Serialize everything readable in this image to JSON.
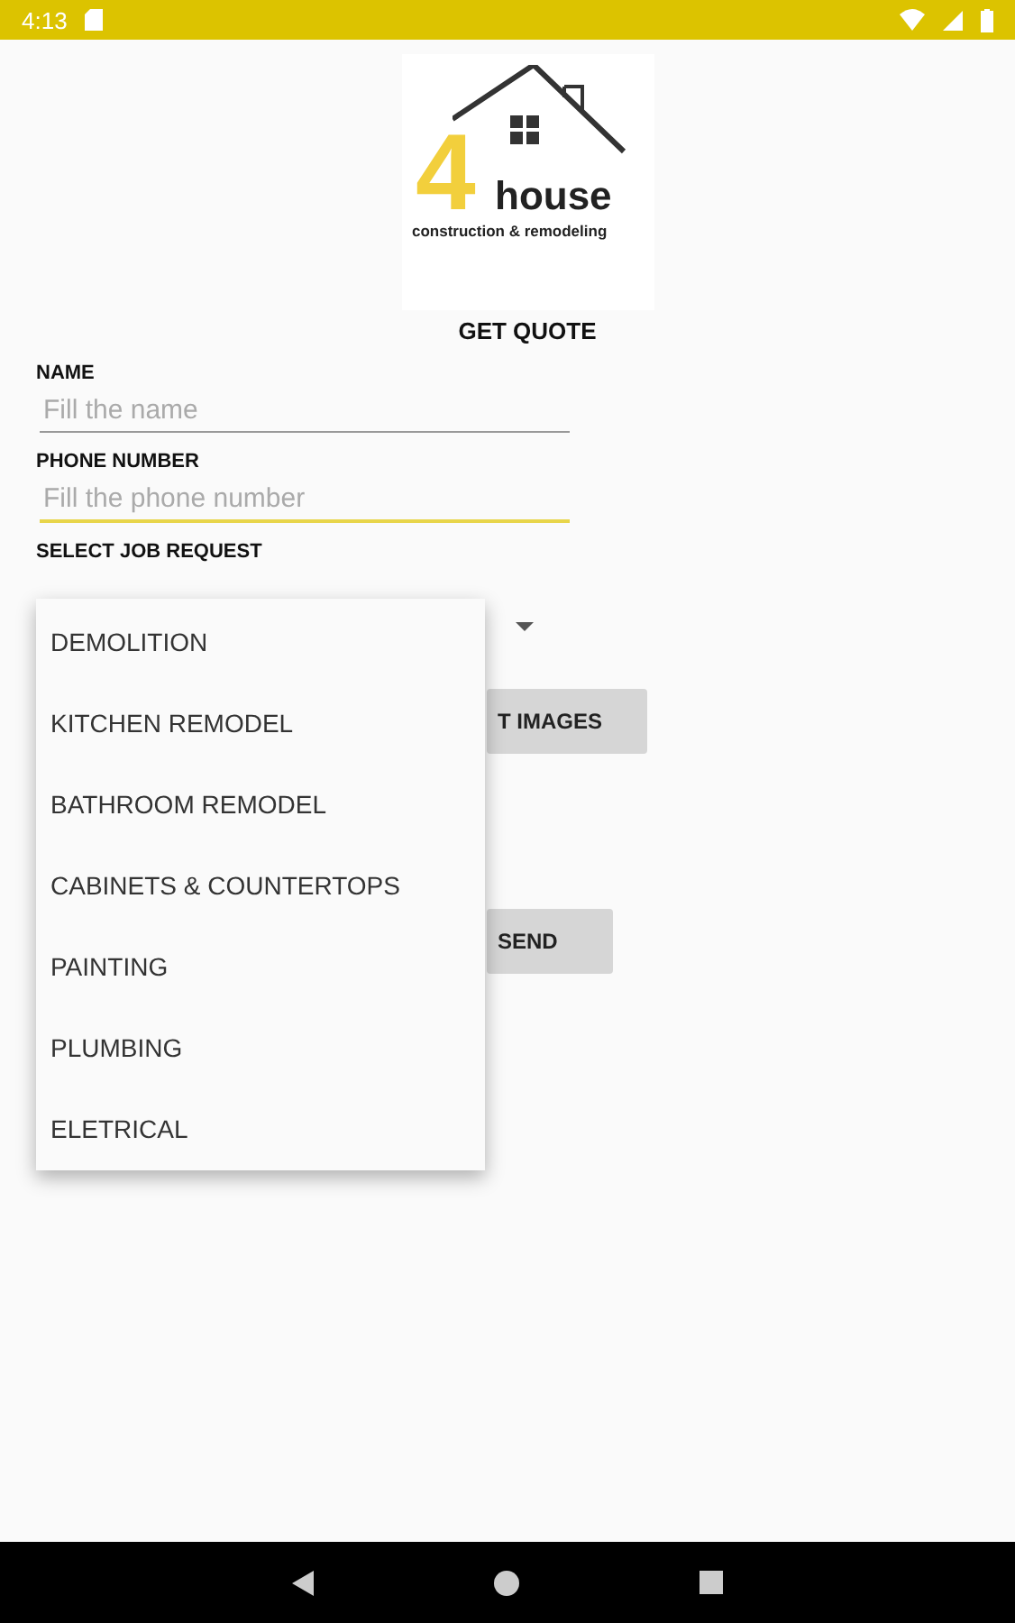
{
  "status_bar": {
    "time": "4:13"
  },
  "logo": {
    "digit": "4",
    "word": "house",
    "tagline": "construction & remodeling"
  },
  "title": "GET QUOTE",
  "fields": [
    {
      "label": "NAME",
      "placeholder": "Fill the name",
      "focused": false
    },
    {
      "label": "PHONE NUMBER",
      "placeholder": "Fill the phone number",
      "focused": true
    }
  ],
  "job_request": {
    "label": "SELECT JOB REQUEST",
    "expanded": true,
    "options": [
      "DEMOLITION",
      "KITCHEN REMODEL",
      "BATHROOM REMODEL",
      "CABINETS & COUNTERTOPS",
      "PAINTING",
      "PLUMBING",
      "ELETRICAL"
    ]
  },
  "buttons": [
    {
      "kind": "images",
      "label": "T IMAGES"
    },
    {
      "kind": "send",
      "label": "SEND"
    }
  ]
}
